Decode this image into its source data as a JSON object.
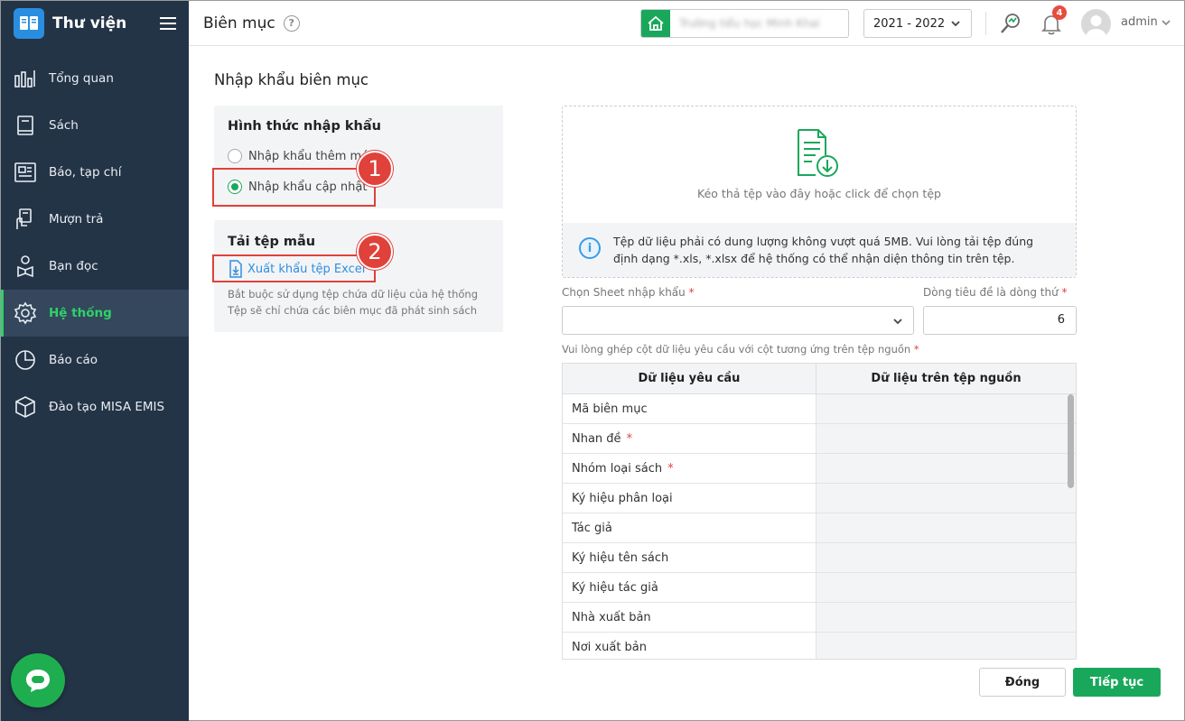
{
  "sidebar": {
    "brand": "Thư viện",
    "items": [
      {
        "label": "Tổng quan",
        "icon": "chart-bars-icon"
      },
      {
        "label": "Sách",
        "icon": "book-icon"
      },
      {
        "label": "Báo, tạp chí",
        "icon": "newspaper-icon"
      },
      {
        "label": "Mượn trả",
        "icon": "borrow-icon"
      },
      {
        "label": "Bạn đọc",
        "icon": "reader-icon"
      },
      {
        "label": "Hệ thống",
        "icon": "gear-icon",
        "active": true
      },
      {
        "label": "Báo cáo",
        "icon": "pie-chart-icon"
      },
      {
        "label": "Đào tạo MISA EMIS",
        "icon": "cube-icon"
      }
    ]
  },
  "header": {
    "title": "Biên mục",
    "school_name": "Trường tiểu học Minh Khai",
    "school_year": "2021 - 2022",
    "notification_count": "4",
    "user": "admin"
  },
  "main": {
    "section_title": "Nhập khẩu biên mục",
    "import_type": {
      "title": "Hình thức nhập khẩu",
      "option_new": "Nhập khẩu thêm mới",
      "option_update": "Nhập khẩu cập nhật",
      "selected": "update"
    },
    "template": {
      "title": "Tải tệp mẫu",
      "link": "Xuất khẩu tệp Excel",
      "hint_line1": "Bắt buộc sử dụng tệp chứa dữ liệu của hệ thống",
      "hint_line2": "Tệp sẽ chỉ chứa các biên mục đã phát sinh sách"
    },
    "callouts": [
      "1",
      "2"
    ],
    "dropzone": {
      "text": "Kéo thả tệp vào đây hoặc click để chọn tệp",
      "info": "Tệp dữ liệu phải có dung lượng không vượt quá 5MB. Vui lòng tải tệp đúng định dạng *.xls, *.xlsx để hệ thống có thể nhận diện thông tin trên tệp."
    },
    "sheet_label": "Chọn Sheet nhập khẩu",
    "sheet_value": "",
    "header_row_label": "Dòng tiêu đề là dòng thứ",
    "header_row_value": "6",
    "mapping_label": "Vui lòng ghép cột dữ liệu yêu cầu với cột tương ứng trên tệp nguồn",
    "mapping": {
      "col_required": "Dữ liệu yêu cầu",
      "col_source": "Dữ liệu trên tệp nguồn",
      "rows": [
        {
          "field": "Mã biên mục",
          "required": false
        },
        {
          "field": "Nhan đề",
          "required": true
        },
        {
          "field": "Nhóm loại sách",
          "required": true
        },
        {
          "field": "Ký hiệu phân loại",
          "required": false
        },
        {
          "field": "Tác giả",
          "required": false
        },
        {
          "field": "Ký hiệu tên sách",
          "required": false
        },
        {
          "field": "Ký hiệu tác giả",
          "required": false
        },
        {
          "field": "Nhà xuất bản",
          "required": false
        },
        {
          "field": "Nơi xuất bản",
          "required": false
        }
      ]
    },
    "buttons": {
      "close": "Đóng",
      "next": "Tiếp tục"
    }
  },
  "colors": {
    "sidebar": "#243447",
    "accent": "#19a85b",
    "callout": "#e0413a",
    "link": "#2f8ee0"
  }
}
